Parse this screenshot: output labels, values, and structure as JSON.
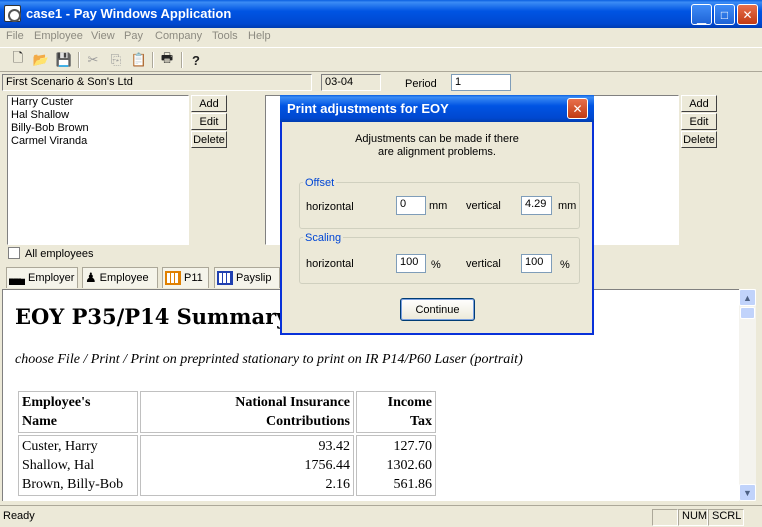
{
  "window": {
    "title": "case1 - Pay Windows Application"
  },
  "menu": [
    "File",
    "Employee",
    "View",
    "Pay",
    "Company",
    "Tools",
    "Help"
  ],
  "toolbar_icons": [
    "new-icon",
    "open-icon",
    "save-icon",
    "cut-icon",
    "copy-icon",
    "paste-icon",
    "print-icon",
    "help-icon"
  ],
  "company": {
    "name": "First  Scenario & Son's Ltd",
    "year": "03-04",
    "period_label": "Period",
    "period": "1"
  },
  "employees": {
    "items": [
      "Harry Custer",
      "Hal Shallow",
      "Billy-Bob Brown",
      "Carmel Viranda"
    ],
    "add": "Add",
    "edit": "Edit",
    "delete": "Delete",
    "all_label": "All employees"
  },
  "right_panel": {
    "add": "Add",
    "edit": "Edit",
    "delete": "Delete"
  },
  "tabs": [
    "Employer",
    "Employee",
    "P11",
    "Payslip"
  ],
  "report": {
    "title": "EOY P35/P14 Summary",
    "subtitle": "choose File / Print / Print on preprinted stationary to print on IR P14/P60 Laser (portrait)",
    "headers": [
      [
        "Employee's",
        "Name"
      ],
      [
        "National Insurance",
        "Contributions"
      ],
      [
        "Income",
        "Tax"
      ]
    ],
    "rows": [
      [
        "Custer, Harry",
        "93.42",
        "127.70"
      ],
      [
        "Shallow, Hal",
        "1756.44",
        "1302.60"
      ],
      [
        "Brown, Billy-Bob",
        "2.16",
        "561.86"
      ]
    ]
  },
  "dialog": {
    "title": "Print adjustments for EOY",
    "message_line1": "Adjustments can be made if there",
    "message_line2": "are alignment problems.",
    "offset": {
      "label": "Offset",
      "h_label": "horizontal",
      "h_value": "0",
      "h_unit": "mm",
      "v_label": "vertical",
      "v_value": "4.29",
      "v_unit": "mm"
    },
    "scaling": {
      "label": "Scaling",
      "h_label": "horizontal",
      "h_value": "100",
      "h_unit": "%",
      "v_label": "vertical",
      "v_value": "100",
      "v_unit": "%"
    },
    "continue": "Continue"
  },
  "status": {
    "text": "Ready",
    "num": "NUM",
    "scrl": "SCRL"
  }
}
